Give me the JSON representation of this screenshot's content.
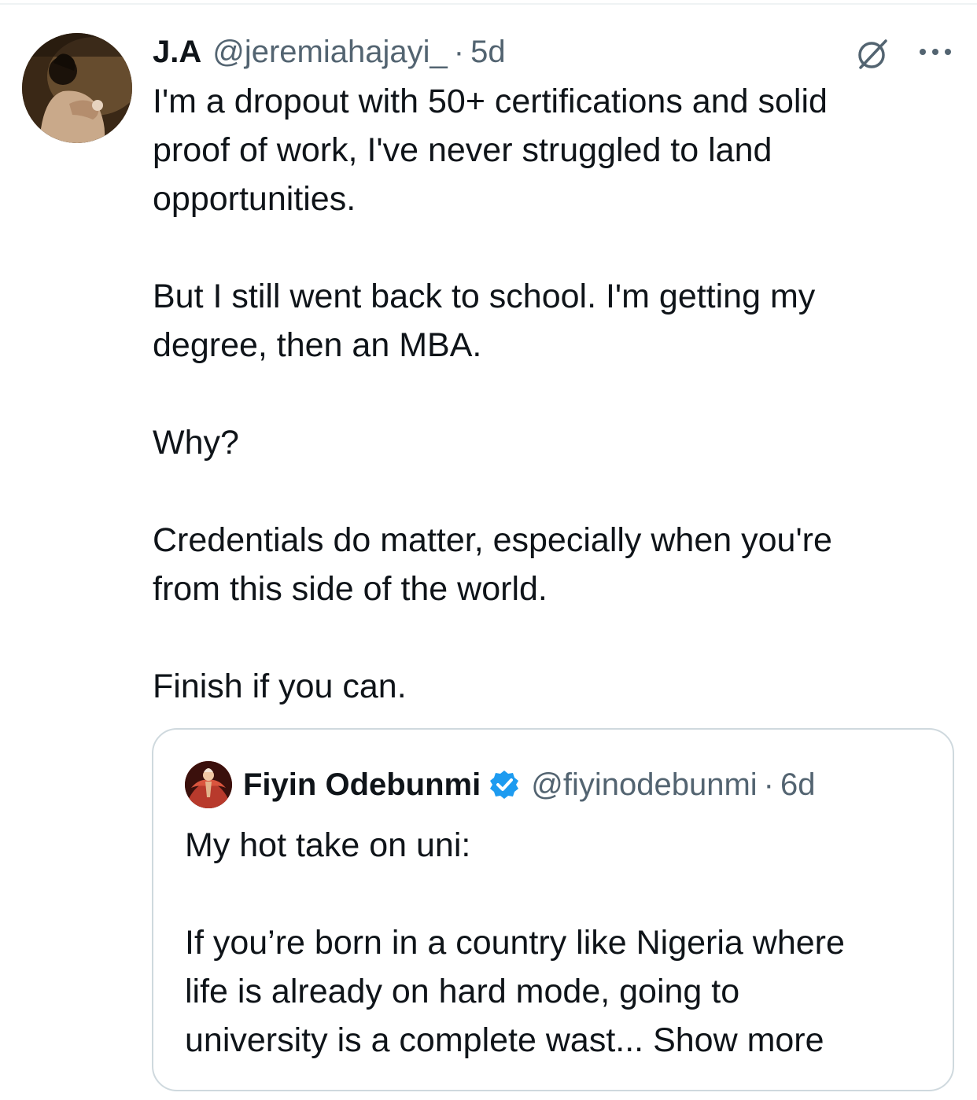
{
  "tweet": {
    "author_name": "J.A",
    "author_handle": "@jeremiahajayi_",
    "separator": "·",
    "timestamp": "5d",
    "icons": {
      "grok": "grok-icon",
      "more": "more-icon"
    },
    "text": "I'm a dropout with 50+ certifications and solid\nproof of work, I've never struggled to land\nopportunities.\n\nBut I still went back to school. I'm getting my\ndegree, then an MBA.\n\nWhy?\n\nCredentials do matter, especially when you're\nfrom this side of the world.\n\nFinish if you can."
  },
  "quote": {
    "author_name": "Fiyin Odebunmi",
    "verified_icon": "verified-badge-icon",
    "author_handle": "@fiyinodebunmi",
    "separator": "·",
    "timestamp": "6d",
    "text": "My hot take on uni:\n\nIf you’re born in a country like Nigeria where\nlife is already on hard mode, going to\nuniversity is a complete wast... ",
    "show_more_label": "Show more"
  },
  "colors": {
    "text_primary": "#0f1419",
    "text_secondary": "#536471",
    "verified_blue": "#1d9bf0",
    "border": "#cfd9de"
  }
}
